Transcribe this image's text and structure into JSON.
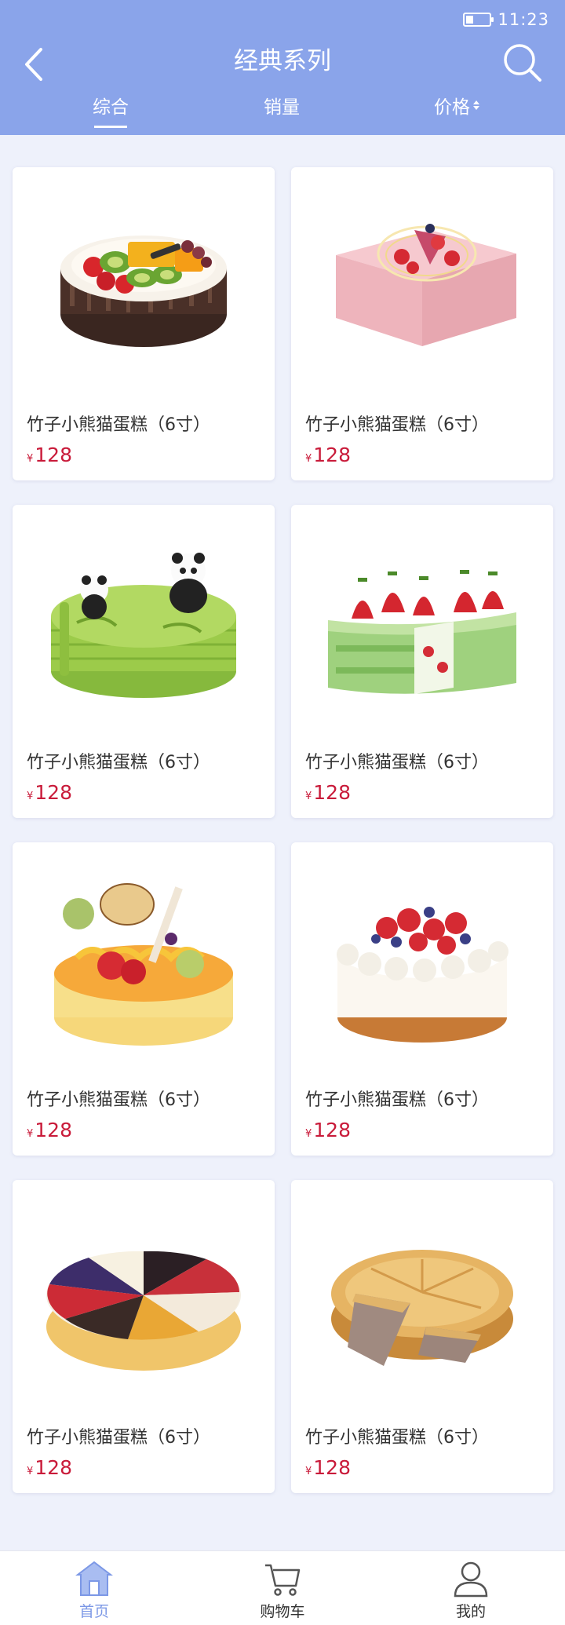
{
  "status_bar": {
    "time": "11:23",
    "battery_level": 0.25
  },
  "header": {
    "title": "经典系列",
    "tabs": [
      {
        "label": "综合",
        "active": true
      },
      {
        "label": "销量",
        "active": false
      },
      {
        "label": "价格",
        "active": false,
        "sortable": true
      }
    ]
  },
  "products": [
    {
      "name": "竹子小熊猫蛋糕（6寸）",
      "currency": "¥",
      "price": "128",
      "image": "fruit-cake"
    },
    {
      "name": "竹子小熊猫蛋糕（6寸）",
      "currency": "¥",
      "price": "128",
      "image": "pink-square-cake"
    },
    {
      "name": "竹子小熊猫蛋糕（6寸）",
      "currency": "¥",
      "price": "128",
      "image": "panda-matcha-cake"
    },
    {
      "name": "竹子小熊猫蛋糕（6寸）",
      "currency": "¥",
      "price": "128",
      "image": "strawberry-matcha-slice"
    },
    {
      "name": "竹子小熊猫蛋糕（6寸）",
      "currency": "¥",
      "price": "128",
      "image": "happy-birthday-cake"
    },
    {
      "name": "竹子小熊猫蛋糕（6寸）",
      "currency": "¥",
      "price": "128",
      "image": "berry-cream-cake"
    },
    {
      "name": "竹子小熊猫蛋糕（6寸）",
      "currency": "¥",
      "price": "128",
      "image": "assorted-slice-cake"
    },
    {
      "name": "竹子小熊猫蛋糕（6寸）",
      "currency": "¥",
      "price": "128",
      "image": "meat-pie"
    }
  ],
  "bottom_nav": [
    {
      "label": "首页",
      "icon": "home-icon",
      "active": true
    },
    {
      "label": "购物车",
      "icon": "cart-icon",
      "active": false
    },
    {
      "label": "我的",
      "icon": "user-icon",
      "active": false
    }
  ],
  "colors": {
    "header": "#8aa4ea",
    "accent": "#7c98e6",
    "price": "#c91b3a",
    "background": "#eef1fb"
  }
}
